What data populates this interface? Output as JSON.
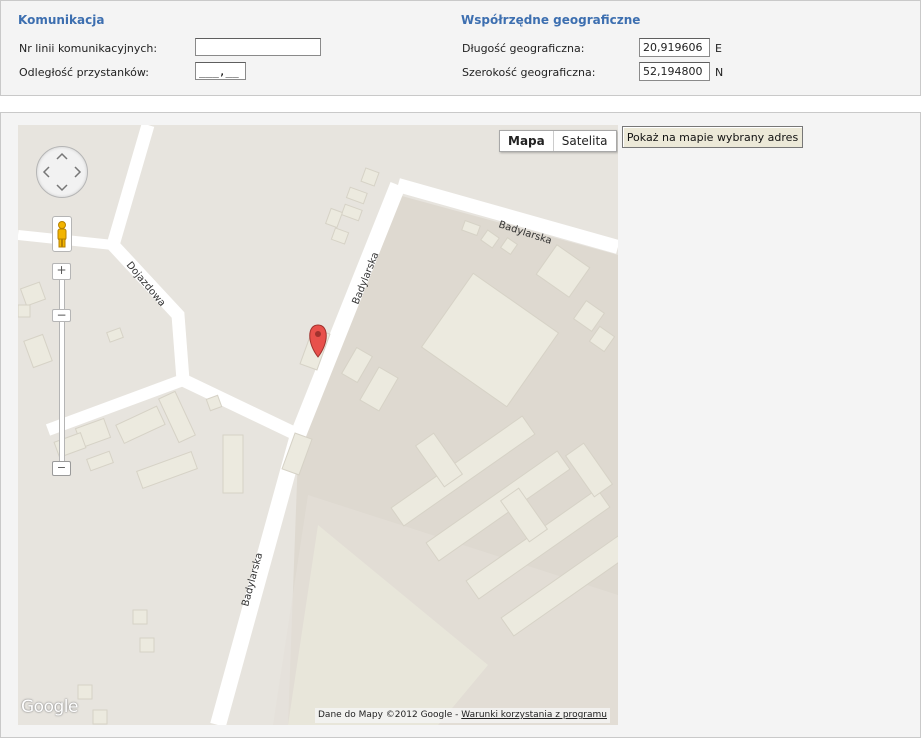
{
  "communication": {
    "title": "Komunikacja",
    "line_numbers_label": "Nr linii komunikacyjnych:",
    "line_numbers_value": "",
    "stop_distance_label": "Odległość przystanków:",
    "stop_distance_value": "___,__"
  },
  "coordinates": {
    "title": "Współrzędne geograficzne",
    "longitude_label": "Długość geograficzna:",
    "longitude_value": "20,919606",
    "longitude_unit": "E",
    "latitude_label": "Szerokość geograficzna:",
    "latitude_value": "52,194800",
    "latitude_unit": "N"
  },
  "map": {
    "type_map_label": "Mapa",
    "type_satellite_label": "Satelita",
    "active_type": "Mapa",
    "street_labels": [
      "Badylarska",
      "Badylarska",
      "Badylarska",
      "Dojazdowa"
    ],
    "logo_text": "Google",
    "attribution_text": "Dane do Mapy ©2012 Google - ",
    "terms_link": "Warunki korzystania z programu",
    "zoom_in_symbol": "+",
    "zoom_out_symbol": "−",
    "zoom_thumb_symbol": "−"
  },
  "actions": {
    "show_address_label": "Pokaż na mapie wybrany adres"
  }
}
